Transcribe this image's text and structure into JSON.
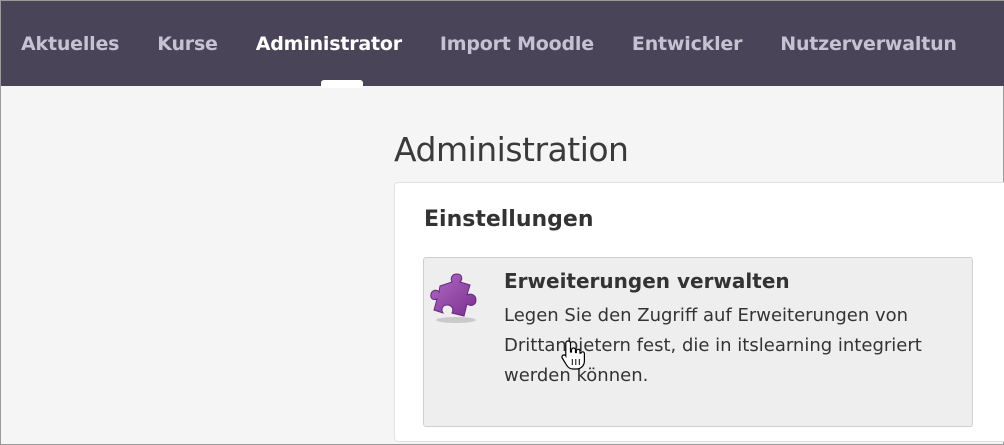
{
  "nav": {
    "items": [
      {
        "label": "Aktuelles",
        "active": false
      },
      {
        "label": "Kurse",
        "active": false
      },
      {
        "label": "Administrator",
        "active": true
      },
      {
        "label": "Import Moodle",
        "active": false
      },
      {
        "label": "Entwickler",
        "active": false
      },
      {
        "label": "Nutzerverwaltun",
        "active": false
      }
    ]
  },
  "page": {
    "title": "Administration"
  },
  "settings": {
    "title": "Einstellungen",
    "card": {
      "icon": "puzzle-piece-icon",
      "title": "Erweiterungen verwalten",
      "description": "Legen Sie den Zugriff auf Erweiterungen von Drittanbietern fest, die in itslearning integriert werden können."
    }
  },
  "colors": {
    "nav_bg": "#4a4458",
    "nav_text": "#c7c2d2",
    "nav_active": "#ffffff",
    "icon_purple": "#8e3fa0"
  }
}
